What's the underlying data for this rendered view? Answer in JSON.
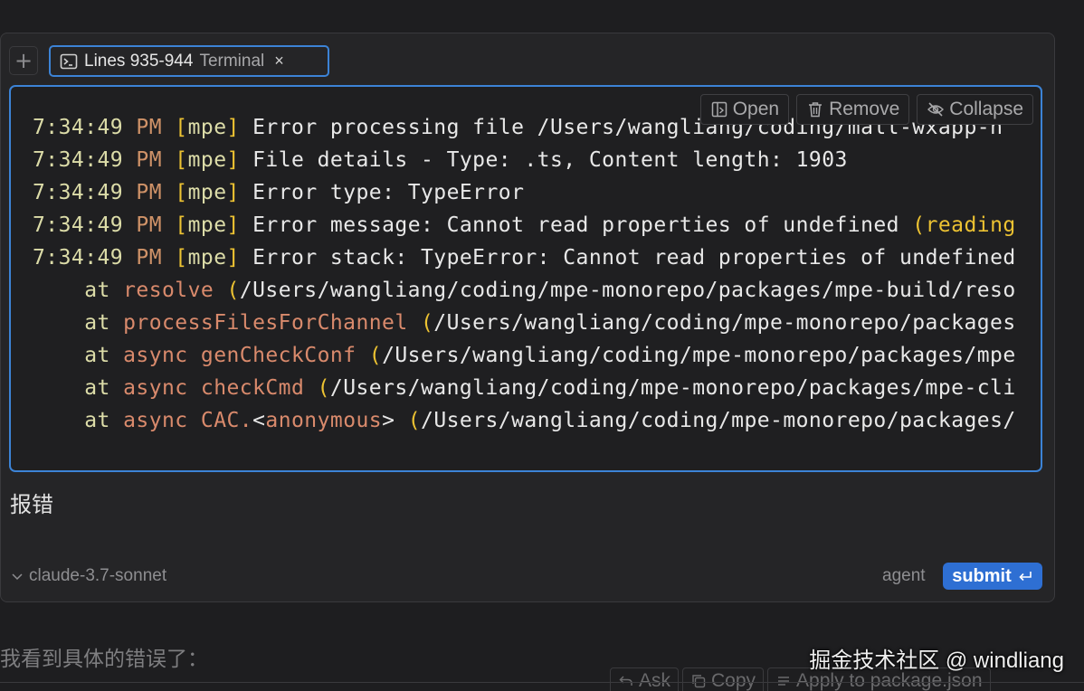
{
  "context_bar": {
    "add_label": "+",
    "chip_label": "Lines 935-944",
    "chip_kind": "Terminal",
    "chip_close": "×"
  },
  "code_block": {
    "actions": [
      {
        "label": "Open",
        "icon": "open-icon"
      },
      {
        "label": "Remove",
        "icon": "trash-icon"
      },
      {
        "label": "Collapse",
        "icon": "eye-off-icon"
      }
    ],
    "lines": [
      [
        {
          "t": "time",
          "v": "7:34:49 "
        },
        {
          "t": "pm",
          "v": "PM "
        },
        {
          "t": "br",
          "v": "["
        },
        {
          "t": "tag",
          "v": "mpe"
        },
        {
          "t": "br",
          "v": "]"
        },
        {
          "t": "txt",
          "v": " Error processing file /Users/wangliang/coding/mall-wxapp-n"
        }
      ],
      [
        {
          "t": "time",
          "v": "7:34:49 "
        },
        {
          "t": "pm",
          "v": "PM "
        },
        {
          "t": "br",
          "v": "["
        },
        {
          "t": "tag",
          "v": "mpe"
        },
        {
          "t": "br",
          "v": "]"
        },
        {
          "t": "txt",
          "v": " File details - Type: .ts, Content length: 1903"
        }
      ],
      [
        {
          "t": "time",
          "v": "7:34:49 "
        },
        {
          "t": "pm",
          "v": "PM "
        },
        {
          "t": "br",
          "v": "["
        },
        {
          "t": "tag",
          "v": "mpe"
        },
        {
          "t": "br",
          "v": "]"
        },
        {
          "t": "txt",
          "v": " Error type: TypeError"
        }
      ],
      [
        {
          "t": "time",
          "v": "7:34:49 "
        },
        {
          "t": "pm",
          "v": "PM "
        },
        {
          "t": "br",
          "v": "["
        },
        {
          "t": "tag",
          "v": "mpe"
        },
        {
          "t": "br",
          "v": "]"
        },
        {
          "t": "txt",
          "v": " Error message: Cannot read properties of undefined "
        },
        {
          "t": "paren",
          "v": "(reading"
        }
      ],
      [
        {
          "t": "time",
          "v": "7:34:49 "
        },
        {
          "t": "pm",
          "v": "PM "
        },
        {
          "t": "br",
          "v": "["
        },
        {
          "t": "tag",
          "v": "mpe"
        },
        {
          "t": "br",
          "v": "]"
        },
        {
          "t": "txt",
          "v": " Error stack: TypeError: Cannot read properties of undefined"
        }
      ],
      [
        {
          "t": "txt",
          "v": "    "
        },
        {
          "t": "at",
          "v": "at "
        },
        {
          "t": "fn",
          "v": "resolve "
        },
        {
          "t": "paren",
          "v": "("
        },
        {
          "t": "txt",
          "v": "/Users/wangliang/coding/mpe-monorepo/packages/mpe-build/reso"
        }
      ],
      [
        {
          "t": "txt",
          "v": "    "
        },
        {
          "t": "at",
          "v": "at "
        },
        {
          "t": "fn",
          "v": "processFilesForChannel "
        },
        {
          "t": "paren",
          "v": "("
        },
        {
          "t": "txt",
          "v": "/Users/wangliang/coding/mpe-monorepo/packages"
        }
      ],
      [
        {
          "t": "txt",
          "v": "    "
        },
        {
          "t": "at",
          "v": "at "
        },
        {
          "t": "fn",
          "v": "async genCheckConf "
        },
        {
          "t": "paren",
          "v": "("
        },
        {
          "t": "txt",
          "v": "/Users/wangliang/coding/mpe-monorepo/packages/mpe"
        }
      ],
      [
        {
          "t": "txt",
          "v": "    "
        },
        {
          "t": "at",
          "v": "at "
        },
        {
          "t": "fn",
          "v": "async checkCmd "
        },
        {
          "t": "paren",
          "v": "("
        },
        {
          "t": "txt",
          "v": "/Users/wangliang/coding/mpe-monorepo/packages/mpe-cli"
        }
      ],
      [
        {
          "t": "txt",
          "v": "    "
        },
        {
          "t": "at",
          "v": "at "
        },
        {
          "t": "fn",
          "v": "async CAC."
        },
        {
          "t": "txt",
          "v": "<"
        },
        {
          "t": "fn",
          "v": "anonymous"
        },
        {
          "t": "txt",
          "v": "> "
        },
        {
          "t": "paren",
          "v": "("
        },
        {
          "t": "txt",
          "v": "/Users/wangliang/coding/mpe-monorepo/packages/"
        }
      ]
    ]
  },
  "prompt": {
    "text": "报错"
  },
  "footer": {
    "model_name": "claude-3.7-sonnet",
    "mode": "agent",
    "submit_label": "submit"
  },
  "reply": {
    "text": "我看到具体的错误了：",
    "actions": [
      "Ask",
      "Copy",
      "Apply to package.json"
    ]
  },
  "watermark": "掘金技术社区 @ windliang",
  "colors": {
    "accent_blue": "#3c83d6",
    "submit_bg": "#2e6fd3",
    "time_yellow": "#dcdca8",
    "bracket_gold": "#ecc232",
    "func_orange": "#d98a6c"
  }
}
